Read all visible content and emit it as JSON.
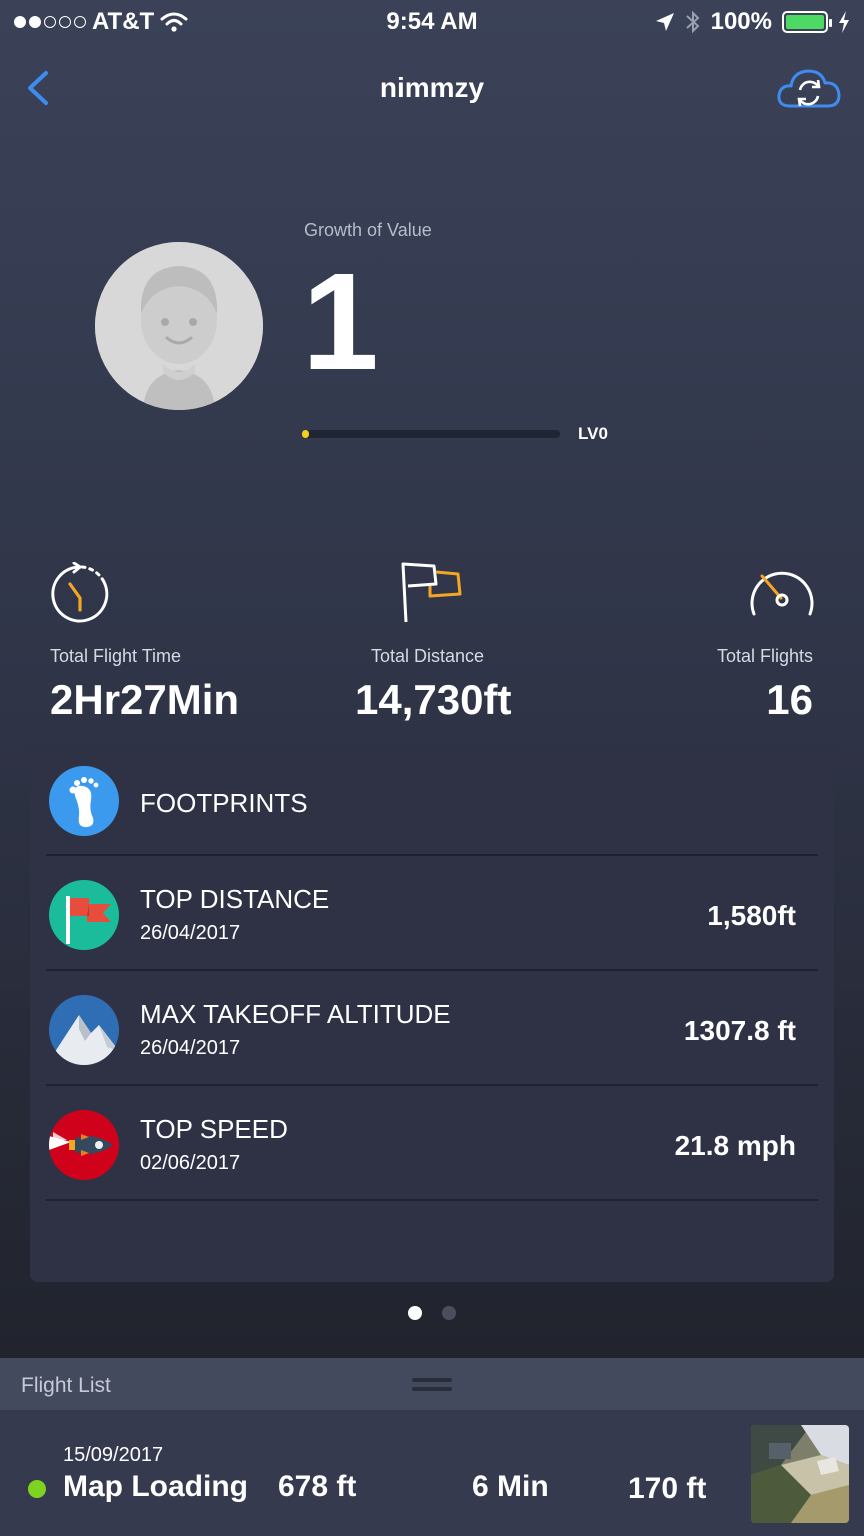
{
  "status_bar": {
    "carrier": "AT&T",
    "time": "9:54 AM",
    "battery": "100%",
    "signal_icon": "signal-dots-icon",
    "wifi_icon": "wifi-icon",
    "location_icon": "location-arrow-icon",
    "bluetooth_icon": "bluetooth-icon",
    "battery_icon": "battery-icon",
    "charging_icon": "charging-bolt-icon"
  },
  "nav": {
    "title": "nimmzy",
    "back_icon": "chevron-left-icon",
    "sync_icon": "cloud-sync-icon"
  },
  "profile": {
    "growth_label": "Growth of Value",
    "growth_value": "1",
    "level_label": "LV0",
    "level_progress": 0.02,
    "avatar_icon": "default-avatar-icon"
  },
  "stats": {
    "flight_time": {
      "label": "Total Flight Time",
      "value": "2Hr27Min",
      "icon": "stopwatch-icon"
    },
    "distance": {
      "label": "Total Distance",
      "value": "14,730ft",
      "icon": "flag-icon"
    },
    "flights": {
      "label": "Total Flights",
      "value": "16",
      "icon": "speedometer-icon"
    }
  },
  "records": {
    "footprints": {
      "title": "FOOTPRINTS",
      "icon": "footprint-icon"
    },
    "top_distance": {
      "title": "TOP DISTANCE",
      "date": "26/04/2017",
      "value": "1,580ft",
      "icon": "red-flag-icon"
    },
    "max_altitude": {
      "title": "MAX TAKEOFF ALTITUDE",
      "date": "26/04/2017",
      "value": "1307.8 ft",
      "icon": "mountain-icon"
    },
    "top_speed": {
      "title": "TOP SPEED",
      "date": "02/06/2017",
      "value": "21.8 mph",
      "icon": "rocket-icon"
    }
  },
  "pager": {
    "pages": 2,
    "current": 1
  },
  "flight_list": {
    "header": "Flight List",
    "items": [
      {
        "date": "15/09/2017",
        "location": "Map Loading",
        "distance": "678 ft",
        "duration": "6 Min",
        "altitude": "170 ft"
      }
    ]
  },
  "colors": {
    "accent_blue": "#3f8cf0",
    "level_yellow": "#f5d020",
    "status_green": "#7ed321",
    "battery_green": "#4cd964"
  }
}
